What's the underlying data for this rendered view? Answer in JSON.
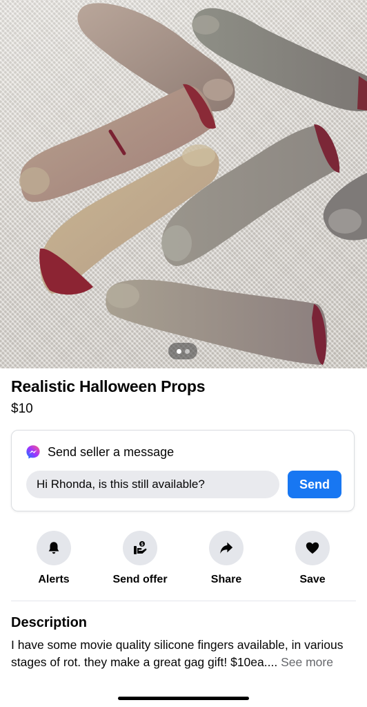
{
  "listing": {
    "title": "Realistic Halloween Props",
    "price": "$10",
    "photo_pager": {
      "total": 2,
      "current": 1
    }
  },
  "message": {
    "header": "Send seller a message",
    "input_value": "Hi Rhonda, is this still available?",
    "send_label": "Send",
    "icon": "messenger-icon",
    "accent": "#1877f2"
  },
  "actions": [
    {
      "label": "Alerts",
      "icon": "bell-icon"
    },
    {
      "label": "Send offer",
      "icon": "offer-icon"
    },
    {
      "label": "Share",
      "icon": "share-icon"
    },
    {
      "label": "Save",
      "icon": "heart-icon"
    }
  ],
  "description": {
    "heading": "Description",
    "text": "I have some movie quality silicone fingers  available, in various stages of rot. they make a great gag gift! $10ea....",
    "see_more": "See more"
  }
}
